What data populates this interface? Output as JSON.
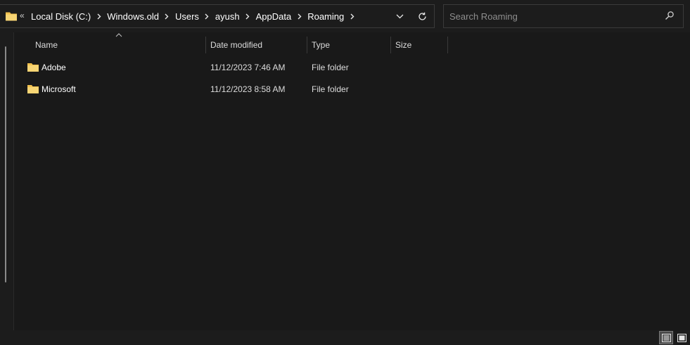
{
  "address_bar": {
    "overflow_label": "«",
    "crumbs": [
      "Local Disk (C:)",
      "Windows.old",
      "Users",
      "ayush",
      "AppData",
      "Roaming"
    ]
  },
  "search": {
    "placeholder": "Search Roaming",
    "value": ""
  },
  "columns": {
    "name": "Name",
    "date_modified": "Date modified",
    "type": "Type",
    "size": "Size"
  },
  "files": [
    {
      "name": "Adobe",
      "date_modified": "11/12/2023 7:46 AM",
      "type": "File folder",
      "size": ""
    },
    {
      "name": "Microsoft",
      "date_modified": "11/12/2023 8:58 AM",
      "type": "File folder",
      "size": ""
    }
  ],
  "colors": {
    "background": "#191919",
    "folder_yellow": "#f2c14e",
    "border": "#3a3a3a",
    "text": "#ffffff",
    "placeholder": "#8e8e8e"
  },
  "icons": {
    "address_folder": "folder-icon",
    "crumb_separator": "chevron-right-icon",
    "dropdown": "chevron-down-icon",
    "refresh": "refresh-icon",
    "search": "search-icon",
    "sort": "sort-ascending-icon",
    "details_view": "details-view-icon",
    "tiles_view": "large-icons-view-icon"
  }
}
